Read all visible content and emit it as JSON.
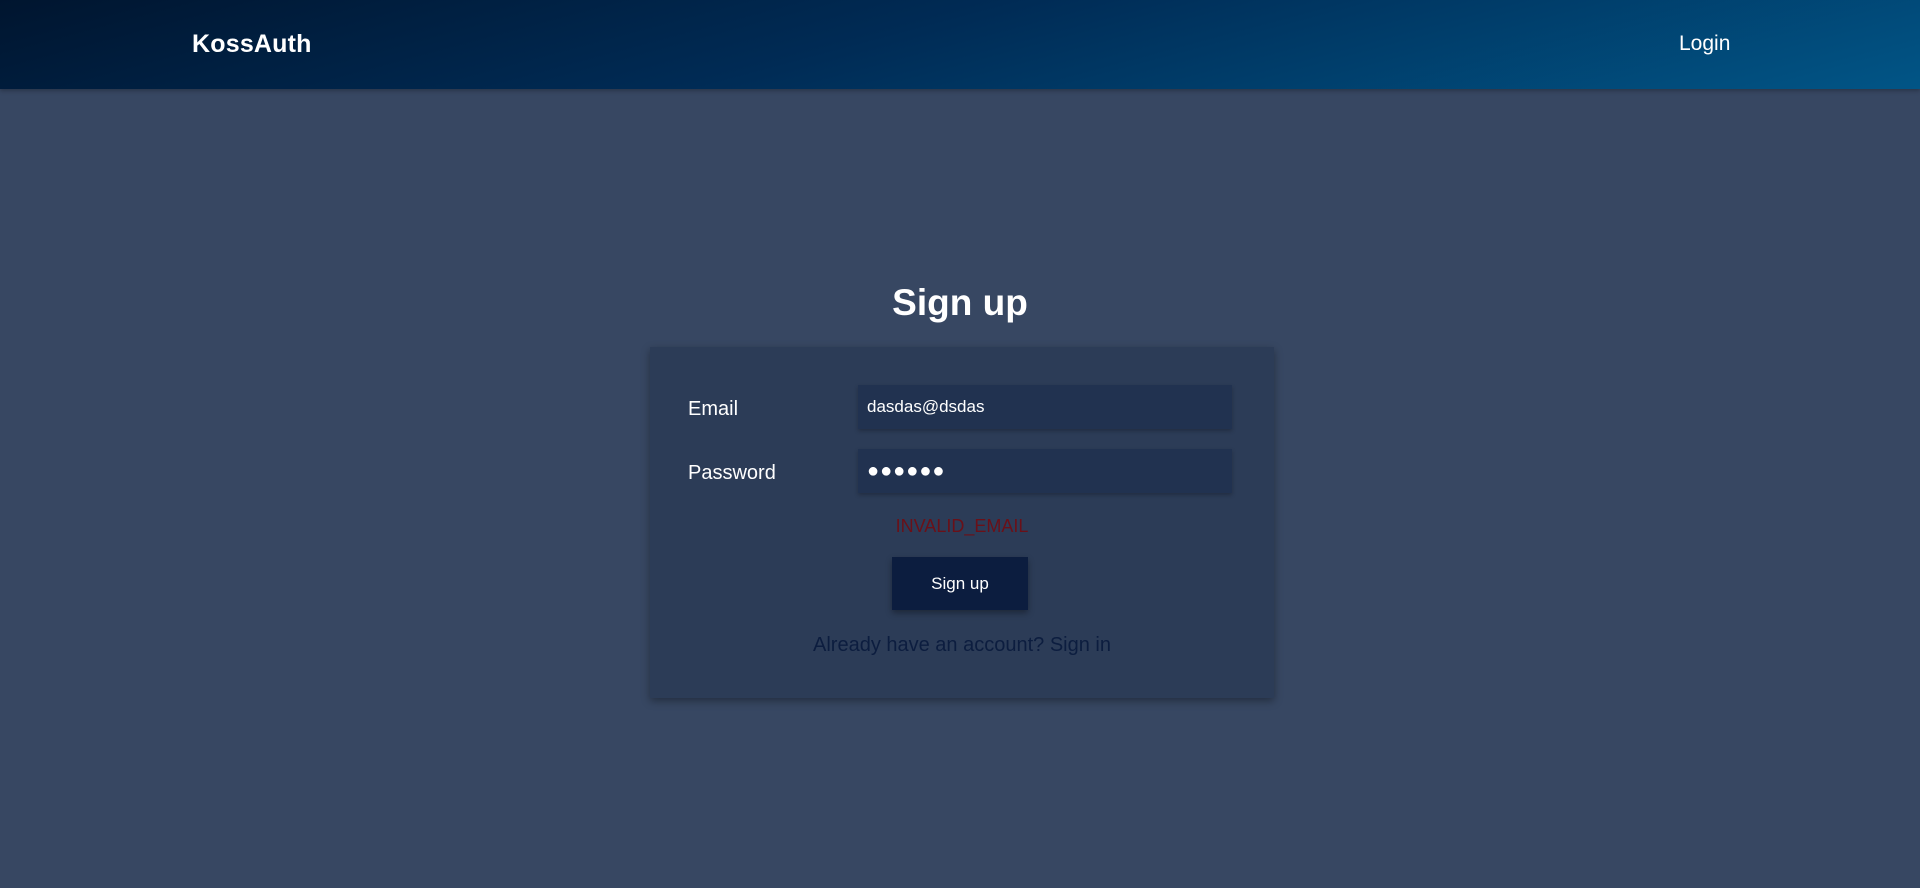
{
  "navbar": {
    "brand": "KossAuth",
    "login_link": "Login"
  },
  "main": {
    "title": "Sign up"
  },
  "form": {
    "email_label": "Email",
    "email_value": "dasdas@dsdas",
    "password_label": "Password",
    "password_value": "●●●●●●",
    "error_message": "INVALID_EMAIL",
    "submit_label": "Sign up",
    "signin_link": "Already have an account? Sign in"
  },
  "colors": {
    "background": "#374762",
    "card": "#2c3c57",
    "input": "#213250",
    "button": "#0c1d3f",
    "error": "#6a1018",
    "link": "#0c1d3f"
  }
}
